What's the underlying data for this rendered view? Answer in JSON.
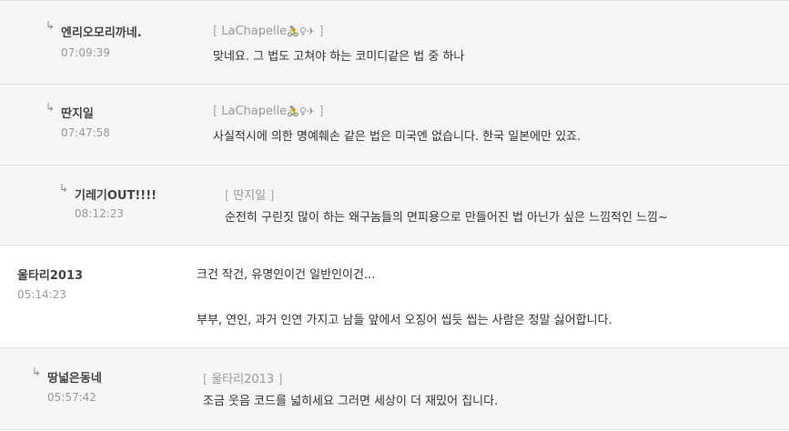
{
  "comments": [
    {
      "nick": "엔리오모리까네.",
      "time": "07:09:39",
      "ref_user": "LaChapelle",
      "ref_emojis": [
        "🚴",
        "♀",
        "✈"
      ],
      "text": "맞네요. 그 법도 고쳐야 하는 코미디같은 법 중 하나"
    },
    {
      "nick": "딴지일",
      "time": "07:47:58",
      "ref_user": "LaChapelle",
      "ref_emojis": [
        "🚴",
        "♀",
        "✈"
      ],
      "text": "사실적시에 의한 명예훼손 같은 법은 미국엔 없습니다. 한국 일본에만 있죠."
    },
    {
      "nick": "기레기OUT!!!!",
      "time": "08:12:23",
      "ref_user": "딴지일",
      "text": "순전히 구린짓 많이 하는 왜구놈들의 면피용으로 만들어진 법 아닌가 싶은 느낌적인 느낌~"
    },
    {
      "nick": "울타리2013",
      "time": "05:14:23",
      "text_line1": "크건 작건, 유명인이건 일반인이건...",
      "text_line2": "부부, 연인, 과거 인연 가지고 남들 앞에서 오징어 씹듯 씹는 사람은 정말 싫어합니다."
    },
    {
      "nick": "땅넓은동네",
      "time": "05:57:42",
      "ref_user": "울타리2013",
      "text": "조금 웃음 코드를 넓히세요 그러면 세상이 더 재밌어 집니다."
    }
  ],
  "symbols": {
    "reply_arrow": "↳",
    "bracket_open": "[",
    "bracket_close": "]"
  },
  "colors": {
    "reply_bg": "#f6f6f6",
    "divider": "#e2e2e2",
    "nick": "#444444",
    "meta": "#999999"
  }
}
